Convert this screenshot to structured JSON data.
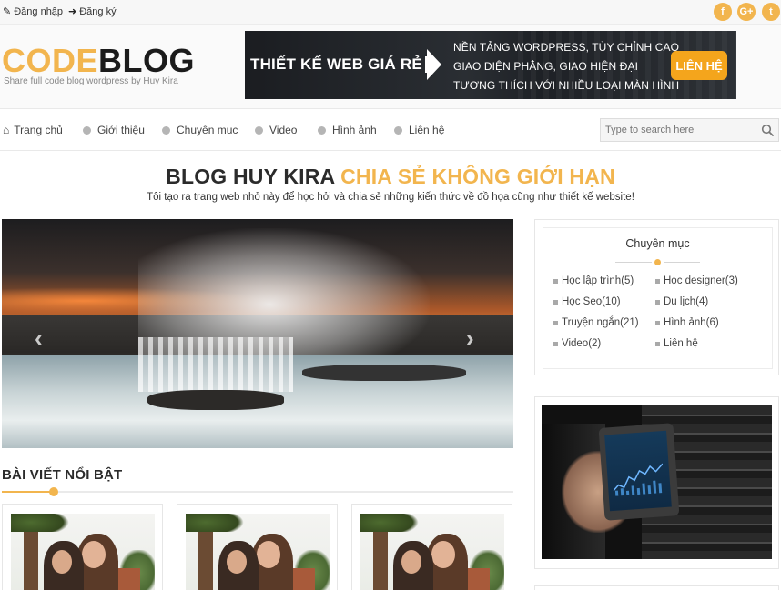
{
  "topbar": {
    "login_label": "Đăng nhập",
    "register_label": "Đăng ký",
    "social": [
      "f",
      "G+",
      "t"
    ]
  },
  "header": {
    "logo_part1": "CODE",
    "logo_part2": "BLOG",
    "tagline": "Share full code blog wordpress by Huy Kira",
    "banner": {
      "main_text": "THIẾT KẾ WEB GIÁ RẺ",
      "line1": "NỀN TẢNG WORDPRESS, TÙY CHỈNH CAO",
      "line2": "GIAO DIỆN PHẲNG, GIAO HIỆN ĐẠI",
      "line3": "TƯƠNG THÍCH VỚI NHIỀU LOẠI MÀN HÌNH",
      "cta": "LIÊN HỆ"
    }
  },
  "nav": {
    "items": [
      "Trang chủ",
      "Giới thiệu",
      "Chuyên mục",
      "Video",
      "Hình ảnh",
      "Liên hệ"
    ],
    "search_placeholder": "Type to search here"
  },
  "hero": {
    "title_part1": "BLOG HUY KIRA",
    "title_part2": "CHIA SẺ KHÔNG GIỚI HẠN",
    "subtitle": "Tôi tạo ra trang web nhỏ này để học hỏi và chia sẻ những kiến thức về đồ họa cũng như thiết kế website!"
  },
  "slider": {
    "prev": "‹",
    "next": "›"
  },
  "featured": {
    "title": "BÀI VIẾT NỔI BẬT"
  },
  "sidebar": {
    "categories_title": "Chuyên mục",
    "categories": [
      "Học lập trình(5)",
      "Học designer(3)",
      "Học Seo(10)",
      "Du lịch(4)",
      "Truyện ngắn(21)",
      "Hình ảnh(6)",
      "Video(2)",
      "Liên hệ"
    ]
  },
  "colors": {
    "accent": "#f2b54e",
    "dark": "#1b1b1b",
    "banner_cta": "#f4a51c"
  },
  "icons": {
    "login": "edit-icon",
    "register": "sign-in-icon",
    "home": "home-icon",
    "search": "search-icon"
  }
}
